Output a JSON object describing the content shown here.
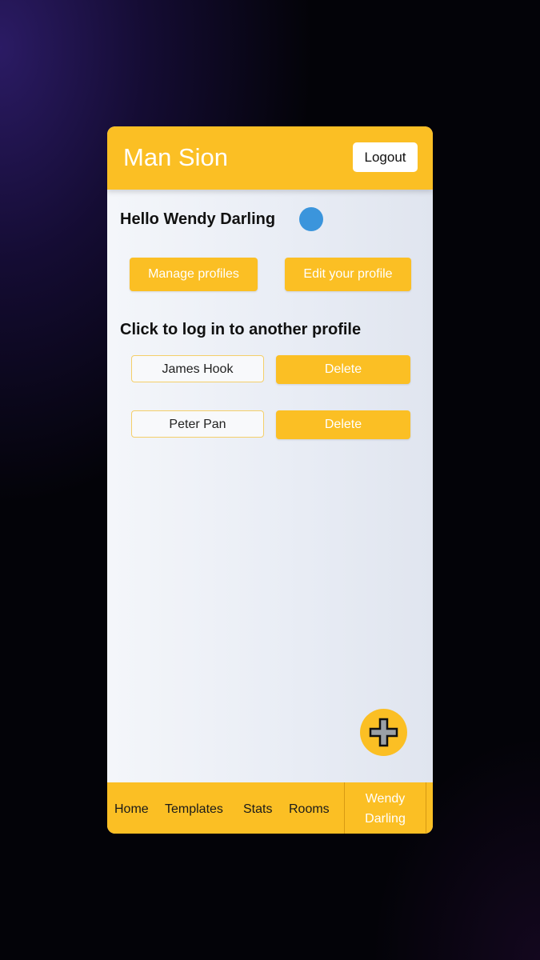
{
  "header": {
    "title": "Man Sion",
    "logout_label": "Logout"
  },
  "greeting": {
    "text": "Hello Wendy Darling",
    "status_color": "#3b95dc"
  },
  "actions": {
    "manage_label": "Manage profiles",
    "edit_label": "Edit your profile"
  },
  "profiles": {
    "title": "Click to log in to another profile",
    "items": [
      {
        "name": "James Hook",
        "delete_label": "Delete"
      },
      {
        "name": "Peter Pan",
        "delete_label": "Delete"
      }
    ]
  },
  "fab": {
    "icon": "plus-icon"
  },
  "nav": {
    "home": "Home",
    "templates": "Templates",
    "stats": "Stats",
    "rooms": "Rooms",
    "user_first": "Wendy",
    "user_last": "Darling"
  },
  "colors": {
    "accent": "#fbbf24",
    "background": "#030308"
  }
}
